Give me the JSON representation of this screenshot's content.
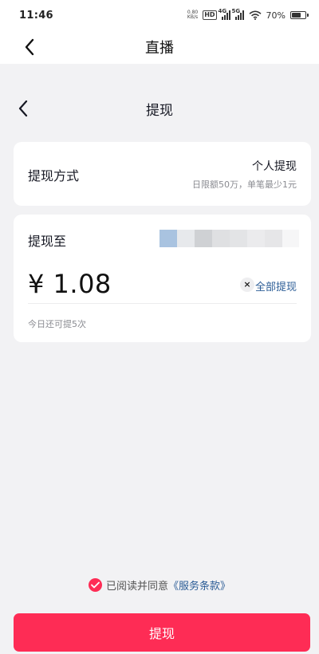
{
  "status_bar": {
    "time": "11:46",
    "net_speed_value": "0.80",
    "net_speed_unit": "KB/s",
    "hd_label": "HD",
    "signal1_label": "4G",
    "signal2_label": "5G",
    "battery_text": "70%",
    "battery_level": 0.7
  },
  "top_nav": {
    "title": "直播",
    "back_icon": "chevron-left-icon"
  },
  "sub_header": {
    "title": "提现",
    "back_icon": "chevron-left-icon"
  },
  "method_card": {
    "label": "提现方式",
    "value": "个人提现",
    "limit_note": "日限额50万，单笔最少1元"
  },
  "amount_card": {
    "to_label": "提现至",
    "account_blurred": true,
    "amount": "¥ 1.08",
    "clear_icon": "close-icon",
    "clear_symbol": "×",
    "withdraw_all": "全部提现",
    "remaining": "今日还可提5次"
  },
  "agreement": {
    "checked": true,
    "text": "已阅读并同意",
    "link": "《服务条款》"
  },
  "submit": {
    "label": "提现"
  },
  "colors": {
    "accent": "#fe2c55",
    "link": "#2b5c96",
    "background": "#f2f2f4",
    "card": "#ffffff",
    "muted_text": "#8a8b91"
  }
}
